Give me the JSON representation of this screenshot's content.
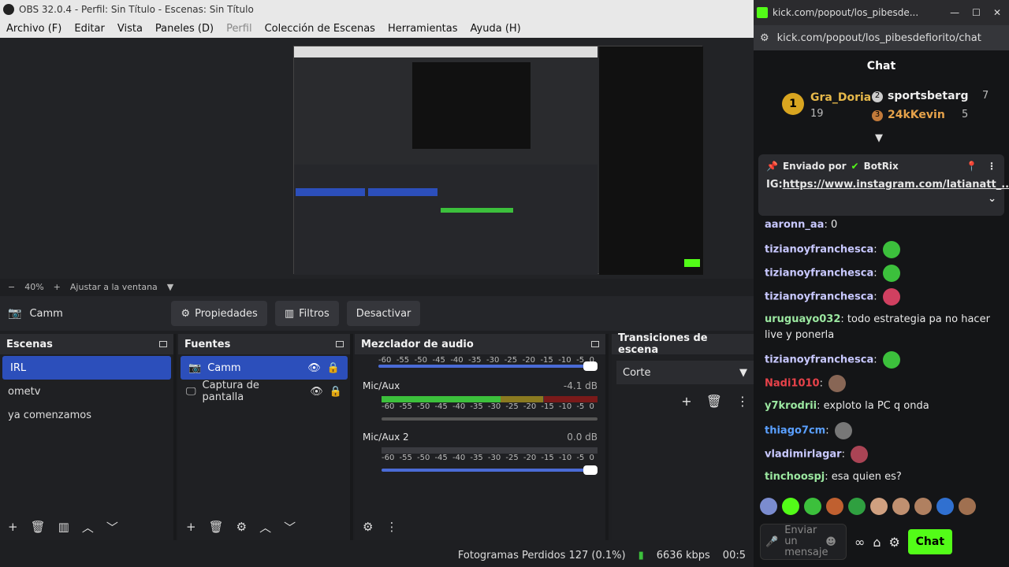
{
  "obs": {
    "title": "OBS 32.0.4 - Perfil: Sin Título - Escenas: Sin Título",
    "menu": [
      "Archivo (F)",
      "Editar",
      "Vista",
      "Paneles (D)",
      "Perfil",
      "Colección de Escenas",
      "Herramientas",
      "Ayuda (H)"
    ],
    "zoom": {
      "minus": "−",
      "value": "40%",
      "plus": "+",
      "fit": "Ajustar a la ventana"
    },
    "source_toolbar": {
      "name": "Camm",
      "props": "Propiedades",
      "filters": "Filtros",
      "deactivate": "Desactivar"
    },
    "scenes": {
      "title": "Escenas",
      "items": [
        "IRL",
        "ometv",
        "ya comenzamos"
      ]
    },
    "sources": {
      "title": "Fuentes",
      "items": [
        "Camm",
        "Captura de pantalla"
      ]
    },
    "mixer": {
      "title": "Mezclador de audio",
      "ticks": [
        "-60",
        "-55",
        "-50",
        "-45",
        "-40",
        "-35",
        "-30",
        "-25",
        "-20",
        "-15",
        "-10",
        "-5",
        "0"
      ],
      "ch1": {
        "name": "Mic/Aux",
        "db": "-4.1 dB"
      },
      "ch2": {
        "name": "Mic/Aux 2",
        "db": "0.0 dB"
      }
    },
    "transitions": {
      "title": "Transiciones de escena",
      "selected": "Corte"
    },
    "status": {
      "dropped": "Fotogramas Perdidos 127 (0.1%)",
      "kbps": "6636 kbps",
      "time": "00:5"
    }
  },
  "browser": {
    "tab_title": "kick.com/popout/los_pibesde...",
    "url": "kick.com/popout/los_pibesdefiorito/chat",
    "chat_title": "Chat",
    "leaders": [
      {
        "rank": "1",
        "name": "Gra_Doria",
        "count": "19"
      },
      {
        "rank": "2",
        "name": "sportsbetarg",
        "count": "7"
      },
      {
        "rank": "3",
        "name": "24kKevin",
        "count": "5"
      }
    ],
    "pinned": {
      "label": "Enviado por",
      "by": "BotRix",
      "prefix": "IG:",
      "link": "https://www.instagram.com/latianatt_..."
    },
    "messages": [
      {
        "user": "aaronn_aa",
        "text": "0",
        "color": "#c8c8ff"
      },
      {
        "user": "tizianoyfranchesca",
        "text": "",
        "color": "#c8c8ff"
      },
      {
        "user": "tizianoyfranchesca",
        "text": "",
        "color": "#c8c8ff"
      },
      {
        "user": "tizianoyfranchesca",
        "text": "",
        "color": "#c8c8ff"
      },
      {
        "user": "uruguayo032",
        "text": "todo estrategia pa no hacer live y ponerla",
        "color": "#9be7a0"
      },
      {
        "user": "tizianoyfranchesca",
        "text": "",
        "color": "#c8c8ff"
      },
      {
        "user": "Nadi1010",
        "text": "",
        "color": "#e8424a"
      },
      {
        "user": "y7krodrii",
        "text": "exploto la PC q onda",
        "color": "#9be7a0"
      },
      {
        "user": "thiago7cm",
        "text": "",
        "color": "#5aa0ff"
      },
      {
        "user": "vladimirlagar",
        "text": "",
        "color": "#c8c8ff"
      },
      {
        "user": "tinchoospj",
        "text": "esa quien es?",
        "color": "#9be7a0"
      }
    ],
    "input_placeholder": "Enviar un mensaje",
    "chat_button": "Chat"
  }
}
